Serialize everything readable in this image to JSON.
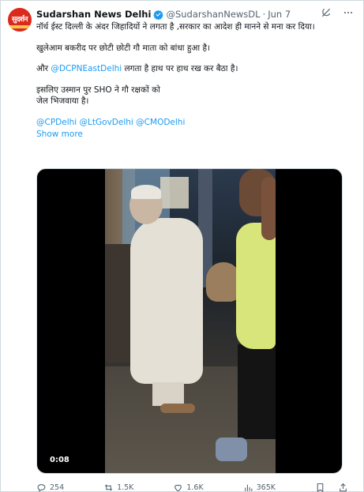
{
  "tweet": {
    "avatar_text": "सुदर्शन",
    "display_name": "Sudarshan News Delhi",
    "handle": "@SudarshanNewsDL",
    "separator": "·",
    "date": "Jun 7",
    "lines": {
      "l1": "नॉर्थ ईस्ट दिल्ली के अंदर जिहादियों ने लगता है ,सरकार का आदेश ही मानने से मना कर दिया।",
      "l2": "खुलेआम बकरीद पर छोटी छोटी गौ माता को बांधा हुआ है।",
      "l3_prefix": "और",
      "l3_mention": "@DCPNEastDelhi",
      "l3_suffix": "लगता है हाथ पर हाथ रख कर बैठा है।",
      "l4a": "इसलिए उस्मान पुर SHO ने गौ रक्षकों को",
      "l4b": "जेल भिजवाया है।",
      "m1": "@CPDelhi",
      "m2": "@LtGovDelhi",
      "m3": "@CMODelhi"
    },
    "show_more": "Show more",
    "video_time": "0:08",
    "metrics": {
      "replies": "254",
      "retweets": "1.5K",
      "likes": "1.6K",
      "views": "365K"
    },
    "accent_color": "#1d9bf0",
    "text_color": "#0f1419",
    "muted_color": "#536471",
    "icons": [
      "verified-badge-icon",
      "grok-icon",
      "more-icon",
      "reply-icon",
      "retweet-icon",
      "like-icon",
      "views-icon",
      "bookmark-icon",
      "share-icon"
    ]
  }
}
